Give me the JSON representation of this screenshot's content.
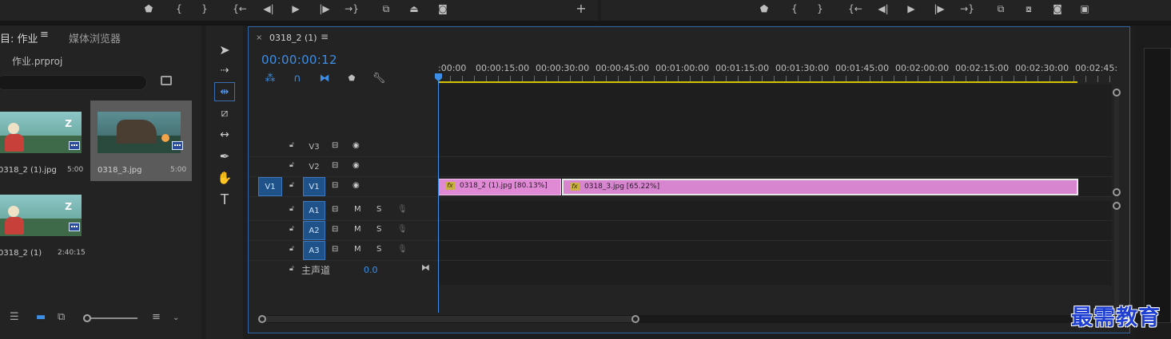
{
  "source_monitor": {
    "controls": [
      "marker-icon",
      "mark-in-icon",
      "mark-out-icon",
      "go-to-in-icon",
      "step-back-icon",
      "play-icon",
      "step-forward-icon",
      "go-to-out-icon",
      "insert-icon",
      "overwrite-icon",
      "export-frame-icon",
      "add-button-icon"
    ],
    "add_label": "+"
  },
  "program_monitor": {
    "controls": [
      "marker-icon",
      "mark-in-icon",
      "mark-out-icon",
      "go-to-in-icon",
      "step-back-icon",
      "play-icon",
      "step-forward-icon",
      "go-to-out-icon",
      "lift-icon",
      "extract-icon",
      "export-frame-icon",
      "compare-icon"
    ]
  },
  "project_panel": {
    "tab_active": "目: 作业",
    "tab_menu": "≡",
    "tab_other": "媒体浏览器",
    "project_file": "作业.prproj",
    "clips": [
      {
        "name": "0318_2 (1).jpg",
        "duration": "5:00"
      },
      {
        "name": "0318_3.jpg",
        "duration": "5:00",
        "selected": true
      },
      {
        "name": "0318_2 (1)",
        "duration": "2:40:15"
      }
    ]
  },
  "tools": [
    "selection-tool",
    "track-select-tool",
    "ripple-edit-tool",
    "razor-tool",
    "slip-tool",
    "pen-tool",
    "hand-tool",
    "type-tool"
  ],
  "timeline": {
    "tab_close": "×",
    "sequence_name": "0318_2 (1)",
    "tab_menu": "≡",
    "timecode": "00:00:00:12",
    "ruler_labels": [
      ":00:00",
      "00:00:15:00",
      "00:00:30:00",
      "00:00:45:00",
      "00:01:00:00",
      "00:01:15:00",
      "00:01:30:00",
      "00:01:45:00",
      "00:02:00:00",
      "00:02:15:00",
      "00:02:30:00",
      "00:02:45:"
    ],
    "video_tracks": [
      {
        "name": "V3",
        "source": ""
      },
      {
        "name": "V2",
        "source": ""
      },
      {
        "name": "V1",
        "source": "V1"
      }
    ],
    "audio_tracks": [
      {
        "name": "A1",
        "m": "M",
        "s": "S"
      },
      {
        "name": "A2",
        "m": "M",
        "s": "S"
      },
      {
        "name": "A3",
        "m": "M",
        "s": "S"
      }
    ],
    "clips": [
      {
        "fx": "fx",
        "label": "0318_2 (1).jpg [80.13%]"
      },
      {
        "fx": "fx",
        "label": "0318_3.jpg [65.22%]"
      }
    ],
    "master": {
      "label": "主声道",
      "value": "0.0"
    }
  },
  "watermark": "最需教育",
  "colors": {
    "accent": "#3d8ee6",
    "clip": "#e08ad6",
    "work_area": "#d6c300"
  }
}
